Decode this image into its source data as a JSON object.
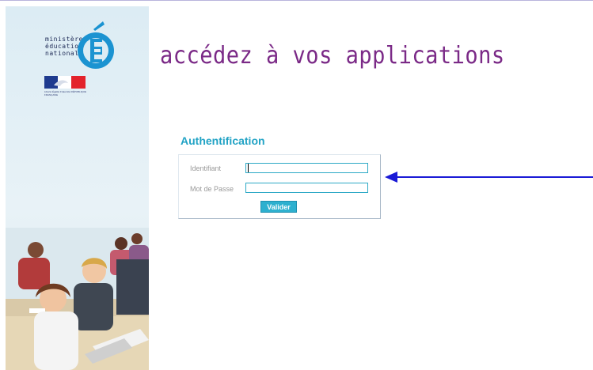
{
  "branding": {
    "ministry_lines": [
      "ministère",
      "éducation",
      "nationale"
    ],
    "flag_caption": "Liberté Égalité Fraternité RÉPUBLIQUE FRANÇAISE",
    "headline": "accédez à vos applications"
  },
  "auth": {
    "title": "Authentification",
    "identifiant_label": "Identifiant",
    "identifiant_value": "",
    "password_label": "Mot de Passe",
    "password_value": "",
    "submit_label": "Valider"
  },
  "colors": {
    "headline": "#7b2a87",
    "title": "#22a3c5",
    "button": "#2db0cf",
    "arrow": "#1a1ad6"
  },
  "icons": [
    "ministry-e-logo",
    "french-flag-logo",
    "annotation-arrow"
  ]
}
